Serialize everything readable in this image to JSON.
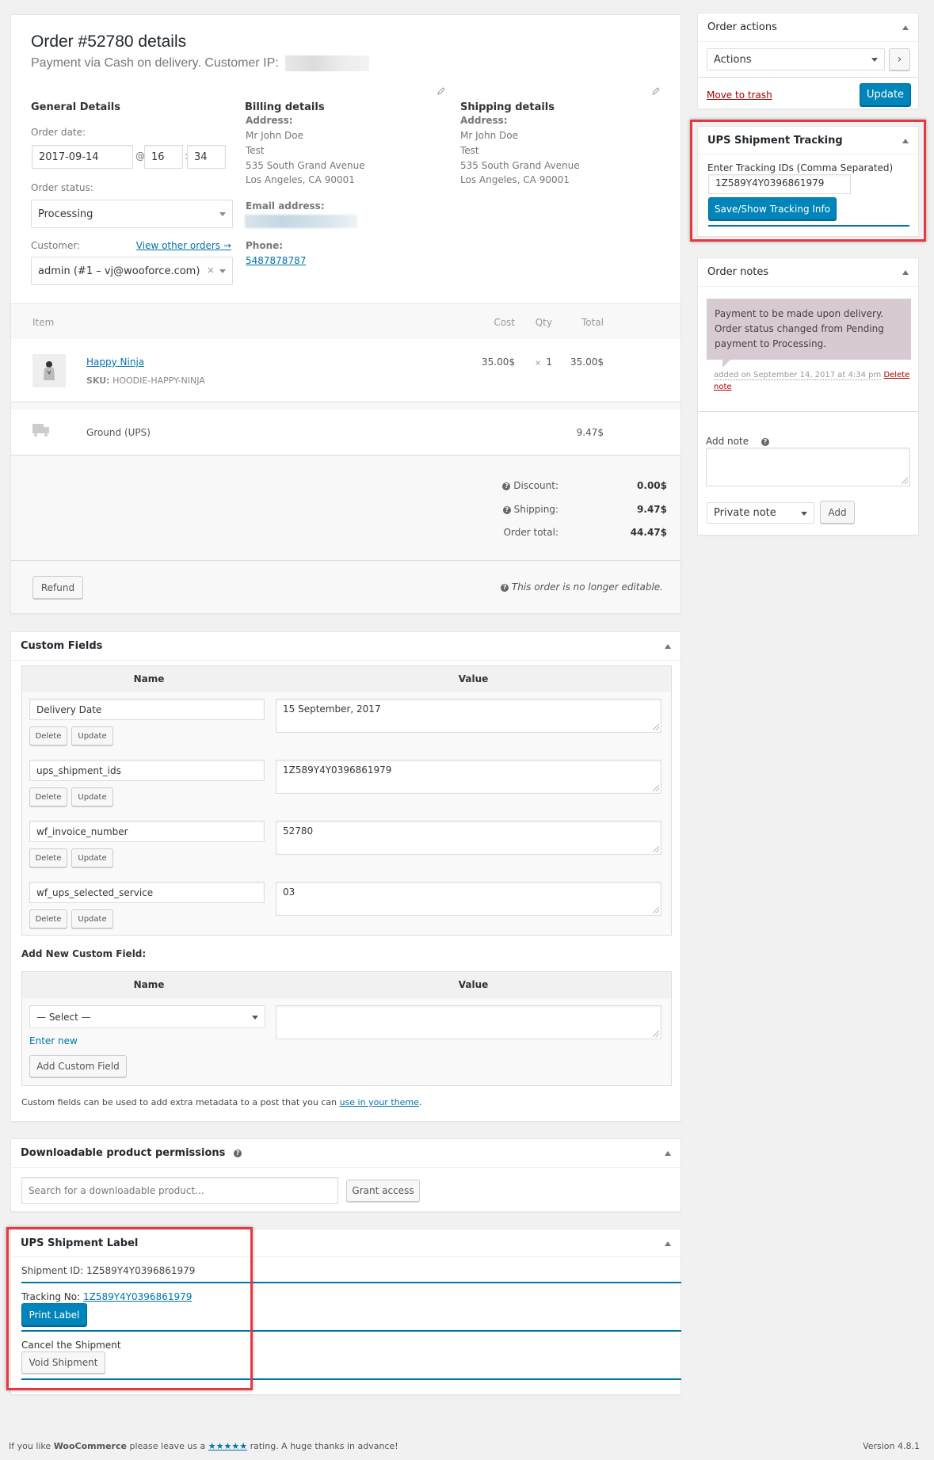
{
  "order": {
    "title": "Order #52780 details",
    "subtitle": "Payment via Cash on delivery. Customer IP:",
    "general": {
      "heading": "General Details",
      "order_date_label": "Order date:",
      "date": "2017-09-14",
      "at": "@",
      "hour": "16",
      "colon": ":",
      "minute": "34",
      "status_label": "Order status:",
      "status": "Processing",
      "customer_label": "Customer:",
      "view_other_orders": "View other orders →",
      "customer": "admin (#1 – vj@wooforce.com)",
      "clear": "×"
    },
    "billing": {
      "heading": "Billing details",
      "address_label": "Address:",
      "address_lines": [
        "Mr John Doe",
        "Test",
        "535 South Grand Avenue",
        "Los Angeles, CA 90001"
      ],
      "email_label": "Email address:",
      "phone_label": "Phone:",
      "phone": "5487878787"
    },
    "shipping": {
      "heading": "Shipping details",
      "address_label": "Address:",
      "address_lines": [
        "Mr John Doe",
        "Test",
        "535 South Grand Avenue",
        "Los Angeles, CA 90001"
      ]
    }
  },
  "items": {
    "headers": {
      "item": "Item",
      "cost": "Cost",
      "qty": "Qty",
      "total": "Total"
    },
    "rows": [
      {
        "name": "Happy Ninja",
        "sku_label": "SKU:",
        "sku": "HOODIE-HAPPY-NINJA",
        "cost": "35.00$",
        "qty_x": "×",
        "qty": "1",
        "total": "35.00$"
      }
    ],
    "shipping_row": {
      "method": "Ground (UPS)",
      "total": "9.47$"
    },
    "totals": [
      {
        "label": "Discount:",
        "value": "0.00$",
        "help": true
      },
      {
        "label": "Shipping:",
        "value": "9.47$",
        "help": true
      },
      {
        "label": "Order total:",
        "value": "44.47$",
        "help": false
      }
    ],
    "refund_button": "Refund",
    "not_editable": "This order is no longer editable."
  },
  "custom_fields": {
    "title": "Custom Fields",
    "col_name": "Name",
    "col_value": "Value",
    "delete_label": "Delete",
    "update_label": "Update",
    "rows": [
      {
        "name": "Delivery Date",
        "value": "15 September, 2017"
      },
      {
        "name": "ups_shipment_ids",
        "value": "1Z589Y4Y0396861979"
      },
      {
        "name": "wf_invoice_number",
        "value": "52780"
      },
      {
        "name": "wf_ups_selected_service",
        "value": "03"
      }
    ],
    "add_new_heading": "Add New Custom Field:",
    "select_placeholder": "— Select —",
    "enter_new": "Enter new",
    "add_button": "Add Custom Field",
    "note_prefix": "Custom fields can be used to add extra metadata to a post that you can ",
    "note_link": "use in your theme",
    "note_suffix": "."
  },
  "downloads": {
    "title": "Downloadable product permissions",
    "search_placeholder": "Search for a downloadable product...",
    "grant_button": "Grant access"
  },
  "ups_label": {
    "title": "UPS Shipment Label",
    "shipment_id_label": "Shipment ID:",
    "shipment_id": "1Z589Y4Y0396861979",
    "tracking_label": "Tracking No:",
    "tracking_no": "1Z589Y4Y0396861979",
    "print_button": "Print Label",
    "cancel_heading": "Cancel the Shipment",
    "void_button": "Void Shipment"
  },
  "order_actions": {
    "title": "Order actions",
    "select_value": "Actions",
    "go_label": "›",
    "trash_label": "Move to trash",
    "update_button": "Update"
  },
  "ups_tracking": {
    "title": "UPS Shipment Tracking",
    "label": "Enter Tracking IDs (Comma Separated)",
    "value": "1Z589Y4Y0396861979",
    "button": "Save/Show Tracking Info"
  },
  "order_notes": {
    "title": "Order notes",
    "note_text": "Payment to be made upon delivery. Order status changed from Pending payment to Processing.",
    "note_meta": "added on September 14, 2017 at 4:34 pm",
    "delete_link": "Delete note",
    "add_note_label": "Add note",
    "note_type": "Private note",
    "add_button": "Add"
  },
  "footer": {
    "prefix": "If you like ",
    "brand": "WooCommerce",
    "middle": " please leave us a ",
    "stars": "★★★★★",
    "suffix": " rating. A huge thanks in advance!",
    "version": "Version 4.8.1"
  }
}
